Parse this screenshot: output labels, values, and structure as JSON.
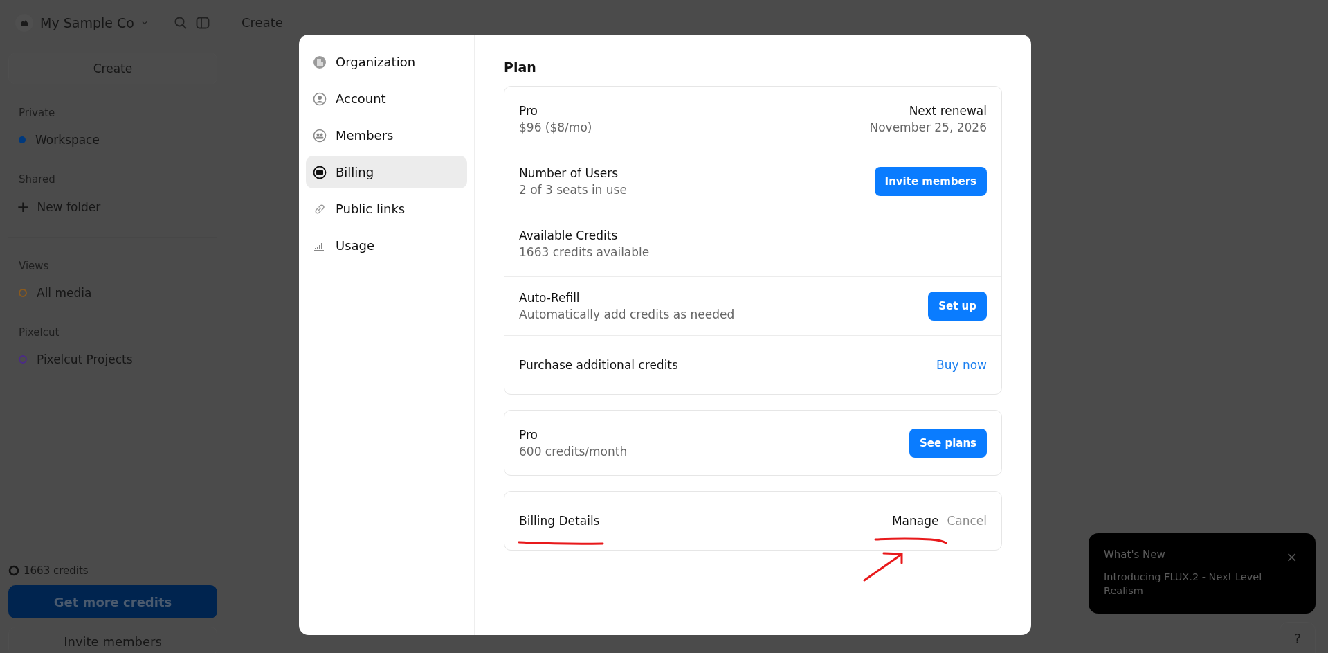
{
  "sidebar": {
    "workspace_name": "My Sample Co",
    "create_button": "Create",
    "sections": [
      {
        "heading": "Private",
        "items": [
          {
            "kind": "dot",
            "label": "Workspace",
            "color": "#00397d"
          }
        ]
      },
      {
        "heading": "Shared",
        "items": [
          {
            "kind": "add",
            "icon_text": "+",
            "label": "New folder"
          }
        ]
      },
      {
        "heading": "Views",
        "items": [
          {
            "kind": "ring",
            "label": "All media",
            "color": "#8a5a1e"
          }
        ]
      },
      {
        "heading": "Pixelcut",
        "items": [
          {
            "kind": "ring",
            "label": "Pixelcut Projects",
            "color": "#4b2b86"
          }
        ]
      }
    ],
    "credits": "1663 credits",
    "primary_button": "Get more credits",
    "secondary_button": "Invite members"
  },
  "header": {
    "title": "Create"
  },
  "settings_dialog": {
    "nav": [
      {
        "label": "Organization",
        "selected": false
      },
      {
        "label": "Account",
        "selected": false
      },
      {
        "label": "Members",
        "selected": false
      },
      {
        "label": "Billing",
        "selected": true
      },
      {
        "label": "Public links",
        "selected": false
      },
      {
        "label": "Usage",
        "selected": false
      }
    ],
    "section_title": "Plan",
    "plan_card": [
      {
        "title": "Pro",
        "subtitle": "$96 ($8/mo)",
        "right_title": "Next renewal",
        "right_subtitle": "November 25, 2026"
      },
      {
        "title": "Number of Users",
        "subtitle": "2 of 3 seats in use",
        "action": {
          "kind": "button",
          "label": "Invite members"
        }
      },
      {
        "title": "Available Credits",
        "subtitle": "1663 credits available"
      },
      {
        "title": "Auto-Refill",
        "subtitle": "Automatically add credits as needed",
        "action": {
          "kind": "button",
          "label": "Set up"
        }
      },
      {
        "title": "Purchase additional credits",
        "action": {
          "kind": "link",
          "label": "Buy now"
        }
      }
    ],
    "tier_card": {
      "title": "Pro",
      "subtitle": "600 credits/month",
      "action": {
        "kind": "button",
        "label": "See plans"
      }
    },
    "billing_card": {
      "title": "Billing Details",
      "actions": [
        {
          "kind": "text",
          "label": "Manage"
        },
        {
          "kind": "muted",
          "label": "Cancel"
        }
      ]
    }
  },
  "toast": {
    "heading": "What's New",
    "message": "Introducing FLUX.2 - Next Level Realism",
    "close": "×"
  },
  "help_button": "?"
}
